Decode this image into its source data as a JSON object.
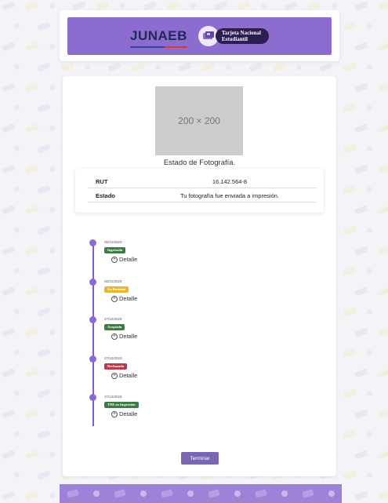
{
  "header": {
    "brand": "JUNAEB",
    "card_line1": "Tarjeta Nacional",
    "card_line2": "Estudiantil"
  },
  "photo": {
    "placeholder_text": "200 × 200",
    "status_title": "Estado de Fotografía."
  },
  "info": {
    "rows": [
      {
        "label": "RUT",
        "value": "16.142.564-8"
      },
      {
        "label": "Estado",
        "value": "Tu fotografía fue enviada a impresión."
      }
    ]
  },
  "timeline": {
    "detail_label": "Detalle",
    "items": [
      {
        "date": "26/12/2023",
        "status": "Ingresada",
        "color": "#3e7b45"
      },
      {
        "date": "26/12/2023",
        "status": "En Revisión",
        "color": "#e8b531"
      },
      {
        "date": "27/12/2023",
        "status": "Aceptada",
        "color": "#3e7b45"
      },
      {
        "date": "27/12/2023",
        "status": "Rechazada",
        "color": "#b83a4b"
      },
      {
        "date": "27/12/2023",
        "status": "TNE en Impresión",
        "color": "#3e7b45"
      }
    ]
  },
  "actions": {
    "finish_label": "Terminar"
  },
  "colors": {
    "brand_purple": "#8c6ccf",
    "dark_navy": "#2c1e52",
    "button": "#7a67b4"
  }
}
